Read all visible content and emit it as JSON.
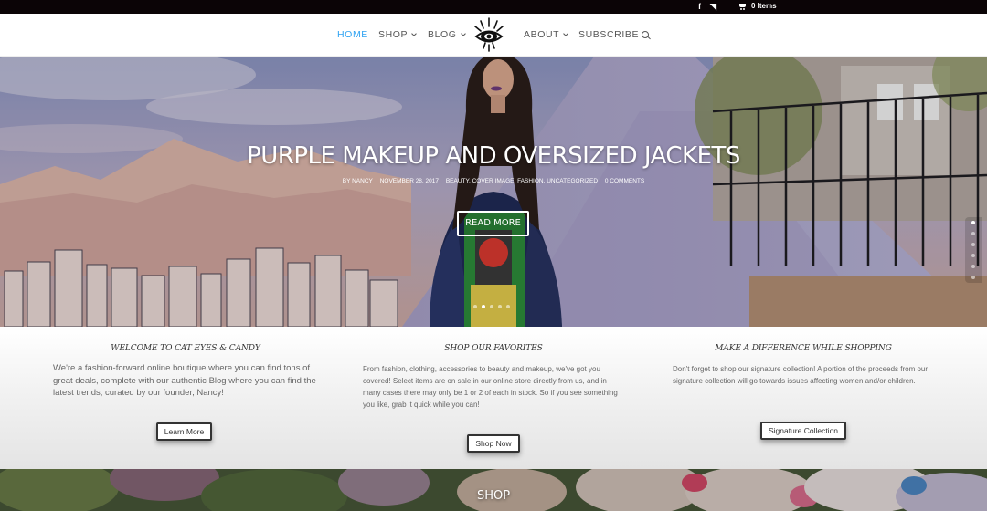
{
  "topbar": {
    "social_icons": [
      "facebook-icon",
      "rss-icon"
    ],
    "facebook_glyph": "f",
    "rss_glyph": "◥",
    "cart_text": "0 Items"
  },
  "nav": {
    "items": [
      {
        "label": "HOME",
        "active": true
      },
      {
        "label": "SHOP"
      },
      {
        "label": "BLOG"
      },
      {
        "label": "ABOUT"
      },
      {
        "label": "SUBSCRIBE"
      }
    ]
  },
  "hero": {
    "title": "Purple Makeup and Oversized Jackets",
    "author": "by Nancy",
    "date": "November 28, 2017",
    "categories": "Beauty, Cover Image, Fashion, Uncategorized",
    "comments": "0 Comments",
    "read_more": "Read More",
    "slides": 5,
    "active_slide": 2
  },
  "features": [
    {
      "title": "Welcome to Cat Eyes & Candy",
      "text": "We're a fashion-forward online boutique where you can find tons of great deals, complete with our authentic Blog where you can find the latest trends, curated by our founder, Nancy!",
      "button": "Learn More"
    },
    {
      "title": "Shop Our Favorites",
      "text": "From fashion, clothing, accessories to beauty and makeup, we've got you covered! Select items are on sale in our online store directly from us, and in many cases there may only be 1 or 2 of each in stock. So if you see something you like, grab it quick while you can!",
      "button": "Shop Now"
    },
    {
      "title": "Make a Difference While Shopping",
      "text": "Don't forget to shop our signature collection!  A portion of the proceeds from our signature collection will go towards issues affecting women and/or children.",
      "button": "Signature Collection"
    }
  ],
  "shop_section": {
    "title": "Shop"
  },
  "colors": {
    "accent": "#2ea3f2",
    "topbar": "#0b0406",
    "nav_text": "#555555"
  }
}
